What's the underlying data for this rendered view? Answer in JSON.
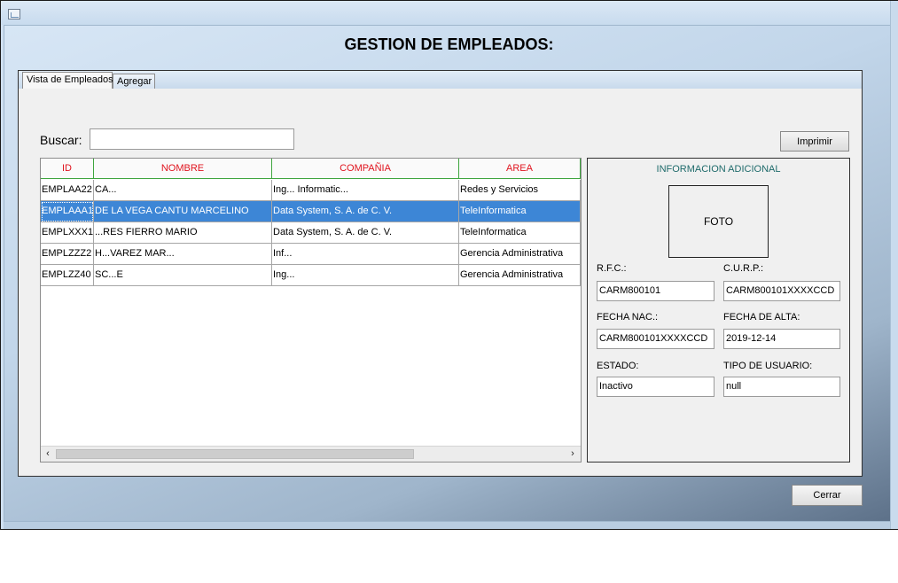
{
  "window": {
    "title": ""
  },
  "page_title": "GESTION DE EMPLEADOS:",
  "tabs": [
    {
      "label": "Vista de Empleados",
      "active": true
    },
    {
      "label": "Agregar",
      "active": false
    }
  ],
  "search": {
    "label": "Buscar:",
    "value": ""
  },
  "print_button": "Imprimir",
  "table": {
    "columns": [
      "ID",
      "NOMBRE",
      "COMPAÑIA",
      "AREA"
    ],
    "rows": [
      {
        "id": "EMPLAA22",
        "nombre": "CA...",
        "compania": "Ing... Informatic...",
        "area": "Redes y Servicios",
        "selected": false
      },
      {
        "id": "EMPLAAA1",
        "nombre": "DE LA VEGA CANTU MARCELINO",
        "compania": "Data System, S. A. de C. V.",
        "area": "TeleInformatica",
        "selected": true
      },
      {
        "id": "EMPLXXX1",
        "nombre": "...RES FIERRO MARIO",
        "compania": "Data System, S. A. de C. V.",
        "area": "TeleInformatica",
        "selected": false
      },
      {
        "id": "EMPLZZZ2",
        "nombre": "H...VAREZ MAR...",
        "compania": "Inf...",
        "area": "Gerencia Administrativa",
        "selected": false
      },
      {
        "id": "EMPLZZ40",
        "nombre": "SC...E",
        "compania": "Ing...",
        "area": "Gerencia Administrativa",
        "selected": false
      }
    ]
  },
  "info": {
    "title": "INFORMACION ADICIONAL",
    "photo_label": "FOTO",
    "rfc_label": "R.F.C.:",
    "rfc_value": "CARM800101",
    "curp_label": "C.U.R.P.:",
    "curp_value": "CARM800101XXXXCCD",
    "fecha_nac_label": "FECHA NAC.:",
    "fecha_nac_value": "CARM800101XXXXCCD",
    "fecha_alta_label": "FECHA DE ALTA:",
    "fecha_alta_value": "2019-12-14",
    "estado_label": "ESTADO:",
    "estado_value": "Inactivo",
    "tipo_usuario_label": "TIPO DE USUARIO:",
    "tipo_usuario_value": "null"
  },
  "close_button": "Cerrar",
  "colors": {
    "header_text": "#e0141e",
    "header_grid": "#3ea53e",
    "selection": "#3d86d6",
    "info_title": "#1f6b6b"
  }
}
